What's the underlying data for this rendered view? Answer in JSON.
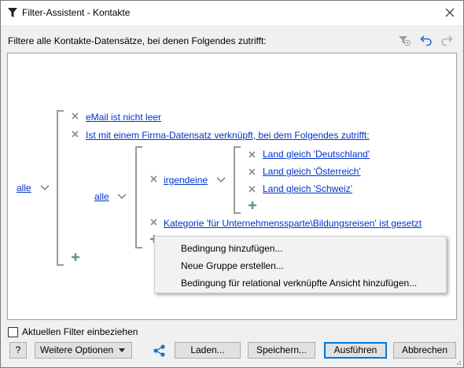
{
  "window": {
    "title": "Filter-Assistent - Kontakte"
  },
  "header": {
    "text": "Filtere alle Kontakte-Datensätze, bei denen Folgendes zutrifft:"
  },
  "tree": {
    "root_quantifier": "alle",
    "conditions": [
      "eMail ist nicht leer",
      "Ist mit einem Firma-Datensatz verknüpft, bei dem Folgendes zutrifft: "
    ],
    "sub_quantifier": "alle",
    "subsub_quantifier": "irgendeine",
    "country_conditions": [
      "Land gleich 'Deutschland'",
      "Land gleich 'Österreich'",
      "Land gleich 'Schweiz'"
    ],
    "category_condition": "Kategorie 'für Unternehmenssparte\\Bildungsreisen' ist gesetzt"
  },
  "context_menu": {
    "items": [
      "Bedingung hinzufügen...",
      "Neue Gruppe erstellen...",
      "Bedingung für relational verknüpfte Ansicht hinzufügen..."
    ]
  },
  "footer": {
    "include_current_filter_label": "Aktuellen Filter einbeziehen",
    "help_label": "?",
    "more_options_label": "Weitere Optionen",
    "load_label": "Laden...",
    "save_label": "Speichern...",
    "execute_label": "Ausführen",
    "cancel_label": "Abbrechen"
  },
  "colors": {
    "link": "#0033cc",
    "plus": "#6a9a7a",
    "primary_border": "#0078d7",
    "share": "#1a73c8"
  }
}
